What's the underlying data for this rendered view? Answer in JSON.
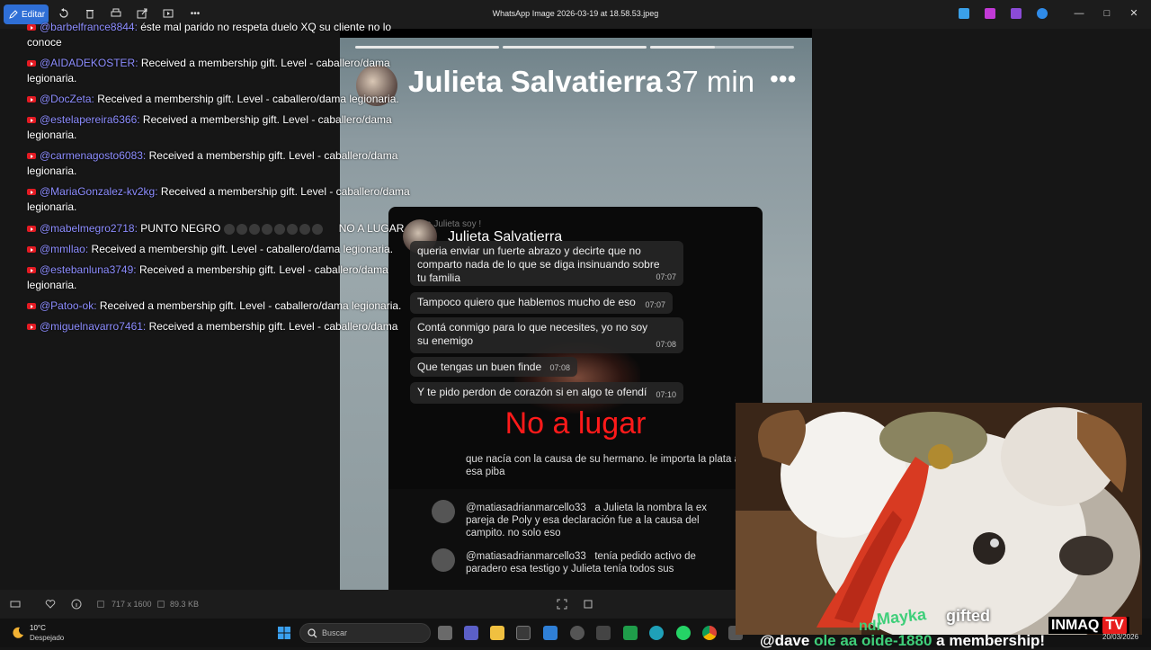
{
  "toolbar": {
    "edit_label": "Editar",
    "window_title": "WhatsApp Image 2026-03-19 at 18.58.53.jpeg",
    "more_label": "•••"
  },
  "chat": {
    "messages": [
      {
        "user": "@barbelfrance8844:",
        "text": " éste mal parido no respeta duelo XQ su cliente no lo conoce"
      },
      {
        "user": "@AIDADEKOSTER:",
        "text": " Received a membership gift. Level - caballero/dama legionaria."
      },
      {
        "user": "@DocZeta:",
        "text": " Received a membership gift. Level - caballero/dama legionaria."
      },
      {
        "user": "@estelapereira6366:",
        "text": " Received a membership gift. Level - caballero/dama legionaria."
      },
      {
        "user": "@carmenagosto6083:",
        "text": " Received a membership gift. Level - caballero/dama legionaria."
      },
      {
        "user": "@MariaGonzalez-kv2kg:",
        "text": " Received a membership gift. Level - caballero/dama legionaria."
      },
      {
        "user": "@mabelmegro2718:",
        "text_before": " PUNTO NEGRO",
        "text_after": "NO A LUGAR"
      },
      {
        "user": "@mmllao:",
        "text": " Received a membership gift. Level - caballero/dama legionaria."
      },
      {
        "user": "@estebanluna3749:",
        "text": " Received a membership gift. Level - caballero/dama legionaria."
      },
      {
        "user": "@Patoo-ok:",
        "text": " Received a membership gift. Level - caballero/dama legionaria."
      },
      {
        "user": "@miguelnavarro7461:",
        "text": " Received a membership gift. Level - caballero/dama"
      }
    ]
  },
  "story": {
    "name": "Julieta Salvatierra",
    "time": "37 min",
    "more": "•••",
    "progress": [
      1,
      1,
      1,
      0.45
    ],
    "inner": {
      "contact_name": "Julieta Salvatierra",
      "preview": "a Julieta soy !",
      "preview_time": "07:07",
      "messages": [
        {
          "text": "queria enviar un fuerte abrazo y decirte que no comparto nada de lo que se diga insinuando sobre tu familia",
          "time": "07:07"
        },
        {
          "text": "Tampoco quiero que hablemos mucho de eso",
          "time": "07:07"
        },
        {
          "text": "Contá conmigo para lo que necesites, yo no soy su enemigo",
          "time": "07:08"
        },
        {
          "text": "Que tengas un buen finde",
          "time": "07:08"
        },
        {
          "text": "Y te pido perdon de corazón si en algo te ofendí",
          "time": "07:10"
        }
      ],
      "overlay_text": "No a lugar",
      "sub_line": "que nacía con la causa de su hermano. le importa la plata a esa piba",
      "comments": [
        {
          "user": "@matiasadrianmarcello33",
          "text": "a Julieta la nombra la ex pareja de Poly y esa declaración fue a la causa del campito. no solo eso"
        },
        {
          "user": "@matiasadrianmarcello33",
          "text": "tenía pedido activo de paradero esa testigo y Julieta tenía todos sus"
        }
      ]
    }
  },
  "overlay": {
    "gifted": "gifted",
    "mayka": "Mayka",
    "ndr": "ndr",
    "bottom_before": "@dave",
    "bottom_mid": "ole aa",
    "bottom_handle": "oide-1880",
    "bottom_after": "a membership!",
    "brand": "INMAQ",
    "brand_tv": "TV",
    "date": "20/03/2026"
  },
  "viewer_status": {
    "dimensions": "717 x 1600",
    "size": "89.3 KB"
  },
  "taskbar": {
    "temp": "10°C",
    "weather": "Despejado",
    "search_placeholder": "Buscar",
    "apps": [
      "widgets-icon",
      "teams-icon",
      "folder-icon",
      "store-icon",
      "outlook-icon",
      "settings-icon",
      "app-icon",
      "excel-icon",
      "edge-icon",
      "whatsapp-icon",
      "chrome-icon",
      "other-icon"
    ]
  }
}
